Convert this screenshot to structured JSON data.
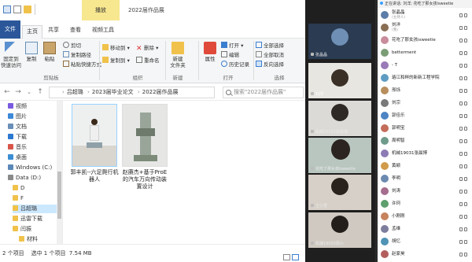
{
  "titlebar": {
    "contextual_tab": "播放",
    "window_title": "2022届作品展"
  },
  "ribbon_tabs": {
    "file": "文件",
    "home": "主页",
    "share": "共享",
    "view": "查看",
    "video_tools": "视频工具"
  },
  "ribbon": {
    "clipboard": {
      "pin": "固定到\n快速访问",
      "copy": "复制",
      "paste": "粘贴",
      "cut": "剪切",
      "copy_path": "复制路径",
      "paste_shortcut": "粘贴快捷方式",
      "label": "剪贴板"
    },
    "organize": {
      "move_to": "移动到",
      "copy_to": "复制到",
      "delete": "删除",
      "rename": "重命名",
      "label": "组织"
    },
    "new": {
      "new_folder": "新建\n文件夹",
      "label": "新建"
    },
    "open": {
      "properties": "属性",
      "open": "打开",
      "edit": "编辑",
      "history": "历史记录",
      "label": "打开"
    },
    "select": {
      "select_all": "全部选择",
      "select_none": "全部取消",
      "invert": "反向选择",
      "label": "选择"
    }
  },
  "address": {
    "crumbs": [
      "吕超璐",
      "2023届毕业论文",
      "2022届作品展"
    ],
    "search_placeholder": "搜索\"2022届作品展\""
  },
  "navpane": {
    "items": [
      {
        "label": "视频",
        "color": "#7a5ae0"
      },
      {
        "label": "图片",
        "color": "#3c8ad8"
      },
      {
        "label": "文档",
        "color": "#6a8fb8"
      },
      {
        "label": "下载",
        "color": "#2b79d0"
      },
      {
        "label": "音乐",
        "color": "#d8554a"
      },
      {
        "label": "桌面",
        "color": "#3b8ed4"
      },
      {
        "label": "Windows (C:)",
        "color": "#5a88b8"
      },
      {
        "label": "Data (D:)",
        "color": "#8a8a8a"
      },
      {
        "label": "D",
        "color": "#f0c24b"
      },
      {
        "label": "F",
        "color": "#f0c24b"
      },
      {
        "label": "吕超璐",
        "color": "#f0c24b"
      },
      {
        "label": "迅雷下载",
        "color": "#f0c24b"
      },
      {
        "label": "闫振",
        "color": "#f0c24b"
      },
      {
        "label": "材料",
        "color": "#f0c24b"
      }
    ]
  },
  "files": [
    {
      "label": "郭丰凯--六足爬行机器人"
    },
    {
      "label": "赵赓杰+基于ProE的汽车万向传动装置设计"
    }
  ],
  "statusbar": {
    "text": "2 个项目    选中 1 个项目  7.54 MB"
  },
  "gallery": {
    "tiles": [
      {
        "name": "张晶晶",
        "bg": "#2a3b52",
        "avatar": "#6f8fb4"
      },
      {
        "name": "刘洋",
        "bg": "#e8e6e0",
        "avatar": "#3a3026"
      },
      {
        "name": "机械19031张晨博",
        "bg": "#dcdad6",
        "avatar": "#2e2924"
      },
      {
        "name": "花吃了那女孩isweetie",
        "bg": "#b9c6c0",
        "avatar": "#2c2420"
      },
      {
        "name": "王小雪",
        "bg": "#d7d0c8",
        "avatar": "#2a221c"
      },
      {
        "name": "机械19035周小",
        "bg": "#cfc9c2",
        "avatar": "#241e1a"
      }
    ]
  },
  "participants": {
    "banner": "正在讲话: 刘洋; 花吃了那女孩isweetie",
    "rows": [
      {
        "name": "张晶晶",
        "sub": "(主持人)",
        "color": "#5b7da8"
      },
      {
        "name": "刘洋",
        "sub": "(我)",
        "color": "#8a6f55"
      },
      {
        "name": "花吃了那女孩isweetie",
        "sub": "",
        "color": "#c98c9c"
      },
      {
        "name": "betterment",
        "sub": "",
        "color": "#7b9d76"
      },
      {
        "name": "- T",
        "sub": "",
        "color": "#9a7ab8"
      },
      {
        "name": "珞江和畔的新新工程学院",
        "sub": "",
        "color": "#5f9cc2"
      },
      {
        "name": "邢烁",
        "sub": "",
        "color": "#b78e5e"
      },
      {
        "name": "刘宗",
        "sub": "",
        "color": "#7a7a7a"
      },
      {
        "name": "郭佳乐",
        "sub": "",
        "color": "#4d84c4"
      },
      {
        "name": "郭明宝",
        "sub": "",
        "color": "#c46d5a"
      },
      {
        "name": "周明智",
        "sub": "",
        "color": "#6f9b8b"
      },
      {
        "name": "机械19031张晨博",
        "sub": "",
        "color": "#8d7bb5"
      },
      {
        "name": "黄颖",
        "sub": "",
        "color": "#d09b4a"
      },
      {
        "name": "李明",
        "sub": "",
        "color": "#6c8ab0"
      },
      {
        "name": "刘涛",
        "sub": "",
        "color": "#a56d8e"
      },
      {
        "name": "许珂",
        "sub": "",
        "color": "#5e9f6d"
      },
      {
        "name": "小刚刚",
        "sub": "",
        "color": "#c7835d"
      },
      {
        "name": "孟维",
        "sub": "",
        "color": "#7d7d9e"
      },
      {
        "name": "胡忆",
        "sub": "",
        "color": "#4f93b5"
      },
      {
        "name": "赵家昊",
        "sub": "",
        "color": "#b35d5d"
      },
      {
        "name": "王博",
        "sub": "",
        "color": "#6d8f55"
      }
    ]
  }
}
